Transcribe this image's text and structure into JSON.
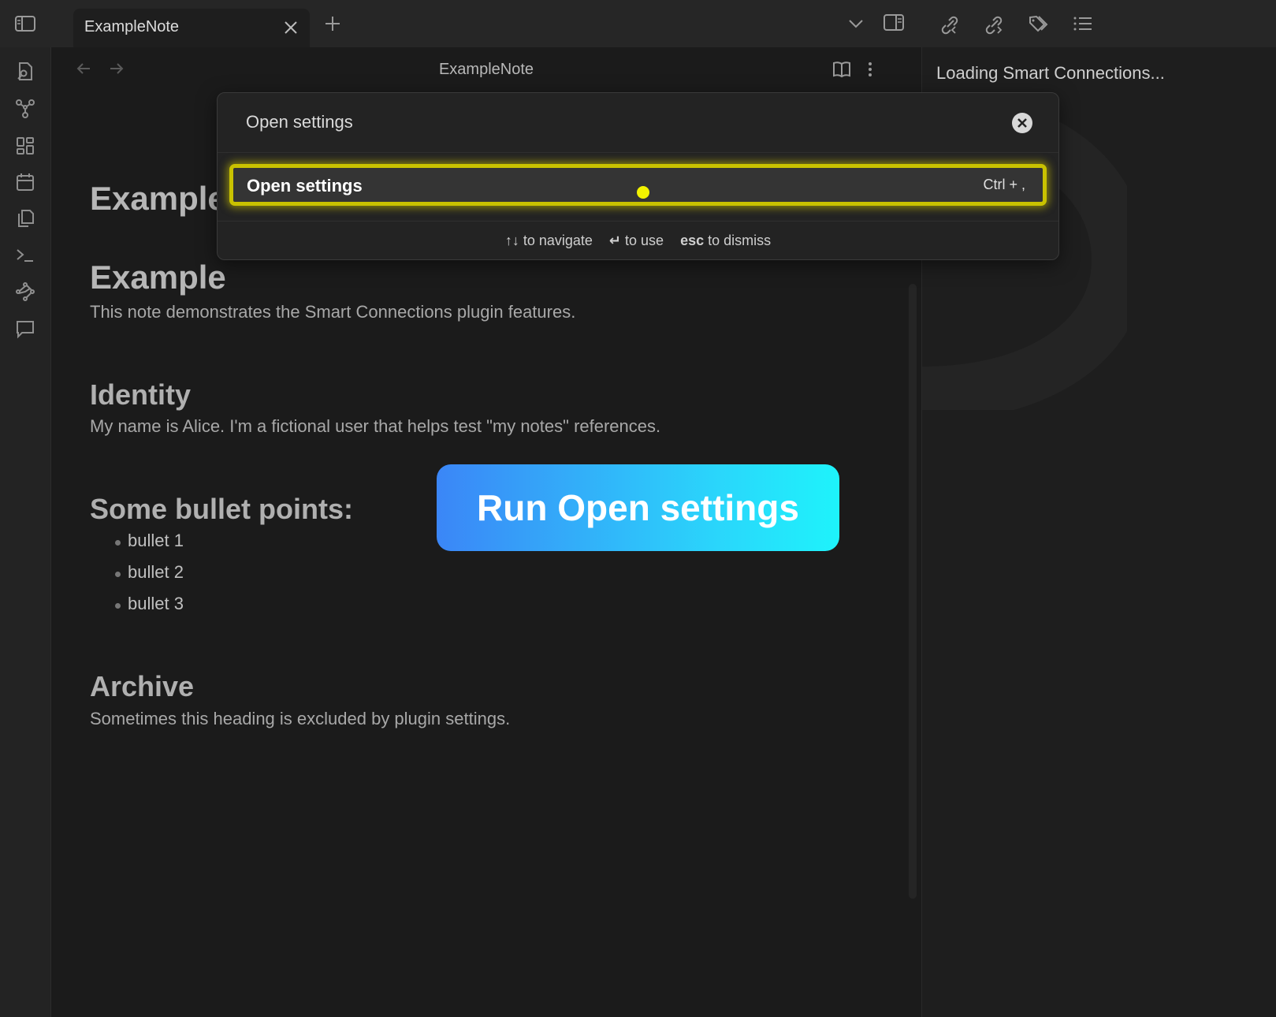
{
  "tabbar": {
    "tab_title": "ExampleNote",
    "icons": [
      "sidebar-toggle-icon",
      "close-icon",
      "plus-icon",
      "chevron-down-icon",
      "right-sidebar-icon",
      "backlinks-icon",
      "outgoing-links-icon",
      "tags-icon",
      "outline-icon"
    ]
  },
  "ribbon": {
    "icons": [
      "open-quick-switcher-icon",
      "graph-view-icon",
      "canvas-icon",
      "daily-note-icon",
      "templates-icon",
      "command-palette-icon",
      "smart-connections-icon",
      "chat-icon"
    ]
  },
  "editor": {
    "view_title": "ExampleNote",
    "h1": "Example",
    "h2": "Example",
    "intro": "This note demonstrates the Smart Connections plugin features.",
    "identity_heading": "Identity",
    "identity_text": "My name is Alice. I'm a fictional user that helps test \"my notes\" references.",
    "bullets_heading": "Some bullet points:",
    "bullets": [
      "bullet 1",
      "bullet 2",
      "bullet 3"
    ],
    "archive_heading": "Archive",
    "archive_text": "Sometimes this heading is excluded by plugin settings."
  },
  "rightpane": {
    "loading_text": "Loading Smart Connections..."
  },
  "modal": {
    "search_value": "Open settings",
    "result_label": "Open settings",
    "result_hotkey": "Ctrl + ,",
    "footer": {
      "navigate_key": "↑↓",
      "navigate_text": "to navigate",
      "use_key": "↵",
      "use_text": "to use",
      "dismiss_key": "esc",
      "dismiss_text": "to dismiss"
    }
  },
  "overlay": {
    "run_label": "Run Open settings"
  },
  "colors": {
    "highlight": "#c9c200",
    "cursor": "#f2f200",
    "run_gradient_start": "#3b86f7",
    "run_gradient_end": "#1ef3fb"
  }
}
